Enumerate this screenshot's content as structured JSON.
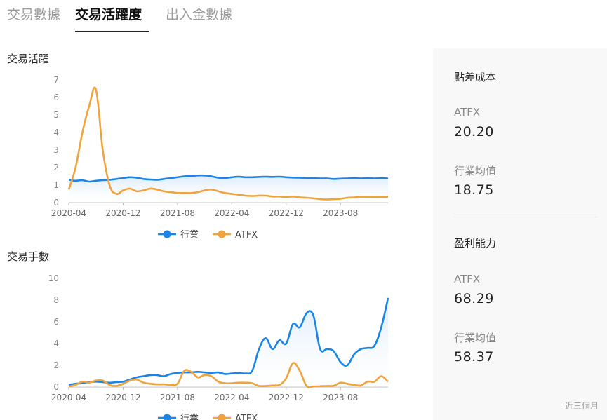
{
  "tabs": [
    {
      "label": "交易數據",
      "active": false
    },
    {
      "label": "交易活躍度",
      "active": true
    },
    {
      "label": "出入金數據",
      "active": false
    }
  ],
  "sections": {
    "activity_title": "交易活躍",
    "lots_title": "交易手數"
  },
  "legend": {
    "industry": "行業",
    "atfx": "ATFX"
  },
  "colors": {
    "industry": "#1a85e8",
    "atfx": "#f0a33c",
    "industry_fill_top": "#d6e8f9"
  },
  "chart_data": [
    {
      "type": "line",
      "title": "交易活躍",
      "x_ticks": [
        "2020-04",
        "2020-12",
        "2021-08",
        "2022-04",
        "2022-12",
        "2023-08"
      ],
      "x_range": [
        "2020-04",
        "2024-03"
      ],
      "ylim": [
        0,
        7
      ],
      "y_ticks": [
        0,
        1,
        2,
        3,
        4,
        5,
        6,
        7
      ],
      "grid": false,
      "legend": "bottom",
      "series": [
        {
          "name": "行業",
          "x": [
            "2020-04",
            "2020-05",
            "2020-06",
            "2020-07",
            "2020-08",
            "2020-09",
            "2020-10",
            "2020-11",
            "2020-12",
            "2021-01",
            "2021-02",
            "2021-03",
            "2021-04",
            "2021-05",
            "2021-06",
            "2021-07",
            "2021-08",
            "2021-09",
            "2021-10",
            "2021-11",
            "2021-12",
            "2022-01",
            "2022-02",
            "2022-03",
            "2022-04",
            "2022-05",
            "2022-06",
            "2022-07",
            "2022-08",
            "2022-09",
            "2022-10",
            "2022-11",
            "2022-12",
            "2023-01",
            "2023-02",
            "2023-03",
            "2023-04",
            "2023-05",
            "2023-06",
            "2023-07",
            "2023-08",
            "2023-09",
            "2023-10",
            "2023-11",
            "2023-12",
            "2024-01",
            "2024-02",
            "2024-03"
          ],
          "values": [
            1.3,
            1.25,
            1.28,
            1.2,
            1.25,
            1.28,
            1.3,
            1.35,
            1.4,
            1.45,
            1.42,
            1.35,
            1.32,
            1.3,
            1.35,
            1.4,
            1.45,
            1.5,
            1.52,
            1.55,
            1.55,
            1.5,
            1.42,
            1.4,
            1.45,
            1.48,
            1.45,
            1.45,
            1.47,
            1.48,
            1.47,
            1.48,
            1.45,
            1.43,
            1.42,
            1.4,
            1.4,
            1.38,
            1.38,
            1.35,
            1.37,
            1.38,
            1.4,
            1.38,
            1.4,
            1.38,
            1.4,
            1.38
          ]
        },
        {
          "name": "ATFX",
          "x": [
            "2020-04",
            "2020-05",
            "2020-06",
            "2020-07",
            "2020-08",
            "2020-09",
            "2020-10",
            "2020-11",
            "2020-12",
            "2021-01",
            "2021-02",
            "2021-03",
            "2021-04",
            "2021-05",
            "2021-06",
            "2021-07",
            "2021-08",
            "2021-09",
            "2021-10",
            "2021-11",
            "2021-12",
            "2022-01",
            "2022-02",
            "2022-03",
            "2022-04",
            "2022-05",
            "2022-06",
            "2022-07",
            "2022-08",
            "2022-09",
            "2022-10",
            "2022-11",
            "2022-12",
            "2023-01",
            "2023-02",
            "2023-03",
            "2023-04",
            "2023-05",
            "2023-06",
            "2023-07",
            "2023-08",
            "2023-09",
            "2023-10",
            "2023-11",
            "2023-12",
            "2024-01",
            "2024-02",
            "2024-03"
          ],
          "values": [
            0.75,
            2.0,
            4.0,
            5.5,
            6.45,
            3.0,
            1.0,
            0.5,
            0.7,
            0.8,
            0.65,
            0.7,
            0.8,
            0.75,
            0.65,
            0.6,
            0.55,
            0.55,
            0.55,
            0.6,
            0.7,
            0.75,
            0.65,
            0.55,
            0.5,
            0.45,
            0.4,
            0.38,
            0.4,
            0.4,
            0.35,
            0.35,
            0.32,
            0.35,
            0.3,
            0.28,
            0.25,
            0.2,
            0.18,
            0.2,
            0.22,
            0.28,
            0.3,
            0.32,
            0.33,
            0.32,
            0.33,
            0.32
          ]
        }
      ]
    },
    {
      "type": "area",
      "title": "交易手數",
      "x_ticks": [
        "2020-04",
        "2020-12",
        "2021-08",
        "2022-04",
        "2022-12",
        "2023-08"
      ],
      "x_range": [
        "2020-04",
        "2024-03"
      ],
      "ylim": [
        0,
        10
      ],
      "y_ticks": [
        0,
        2,
        4,
        6,
        8,
        10
      ],
      "grid": false,
      "legend": "bottom",
      "series": [
        {
          "name": "行業",
          "x": [
            "2020-04",
            "2020-05",
            "2020-06",
            "2020-07",
            "2020-08",
            "2020-09",
            "2020-10",
            "2020-11",
            "2020-12",
            "2021-01",
            "2021-02",
            "2021-03",
            "2021-04",
            "2021-05",
            "2021-06",
            "2021-07",
            "2021-08",
            "2021-09",
            "2021-10",
            "2021-11",
            "2021-12",
            "2022-01",
            "2022-02",
            "2022-03",
            "2022-04",
            "2022-05",
            "2022-06",
            "2022-07",
            "2022-08",
            "2022-09",
            "2022-10",
            "2022-11",
            "2022-12",
            "2023-01",
            "2023-02",
            "2023-03",
            "2023-04",
            "2023-05",
            "2023-06",
            "2023-07",
            "2023-08",
            "2023-09",
            "2023-10",
            "2023-11",
            "2023-12",
            "2024-01",
            "2024-02",
            "2024-03"
          ],
          "values": [
            0.2,
            0.3,
            0.35,
            0.45,
            0.5,
            0.45,
            0.4,
            0.45,
            0.5,
            0.7,
            0.9,
            1.0,
            1.1,
            1.1,
            1.0,
            1.2,
            1.3,
            1.35,
            1.35,
            1.4,
            1.35,
            1.3,
            1.35,
            1.2,
            1.25,
            1.3,
            1.25,
            1.5,
            3.5,
            4.5,
            3.5,
            4.3,
            4.0,
            5.8,
            5.5,
            6.8,
            6.6,
            3.5,
            3.5,
            3.3,
            2.3,
            2.0,
            3.0,
            3.5,
            3.6,
            3.8,
            5.5,
            8.2
          ]
        },
        {
          "name": "ATFX",
          "x": [
            "2020-04",
            "2020-05",
            "2020-06",
            "2020-07",
            "2020-08",
            "2020-09",
            "2020-10",
            "2020-11",
            "2020-12",
            "2021-01",
            "2021-02",
            "2021-03",
            "2021-04",
            "2021-05",
            "2021-06",
            "2021-07",
            "2021-08",
            "2021-09",
            "2021-10",
            "2021-11",
            "2021-12",
            "2022-01",
            "2022-02",
            "2022-03",
            "2022-04",
            "2022-05",
            "2022-06",
            "2022-07",
            "2022-08",
            "2022-09",
            "2022-10",
            "2022-11",
            "2022-12",
            "2023-01",
            "2023-02",
            "2023-03",
            "2023-04",
            "2023-05",
            "2023-06",
            "2023-07",
            "2023-08",
            "2023-09",
            "2023-10",
            "2023-11",
            "2023-12",
            "2024-01",
            "2024-02",
            "2024-03"
          ],
          "values": [
            0.05,
            0.2,
            0.5,
            0.4,
            0.6,
            0.6,
            0.2,
            0.1,
            0.3,
            0.6,
            0.7,
            0.4,
            0.3,
            0.25,
            0.25,
            0.2,
            0.3,
            1.5,
            1.4,
            0.9,
            1.1,
            1.0,
            0.5,
            0.35,
            0.35,
            0.4,
            0.4,
            0.35,
            0.1,
            0.1,
            0.15,
            0.2,
            0.8,
            2.2,
            1.5,
            0.1,
            0.05,
            0.08,
            0.1,
            0.12,
            0.4,
            0.3,
            0.2,
            0.15,
            0.5,
            0.5,
            1.0,
            0.5
          ]
        }
      ]
    }
  ],
  "right_panel": {
    "spread_cost": {
      "title": "點差成本",
      "atfx_label": "ATFX",
      "atfx_value": "20.20",
      "industry_label": "行業均值",
      "industry_value": "18.75"
    },
    "profitability": {
      "title": "盈利能力",
      "atfx_label": "ATFX",
      "atfx_value": "68.29",
      "industry_label": "行業均值",
      "industry_value": "58.37"
    },
    "footnote": "近三個月"
  }
}
